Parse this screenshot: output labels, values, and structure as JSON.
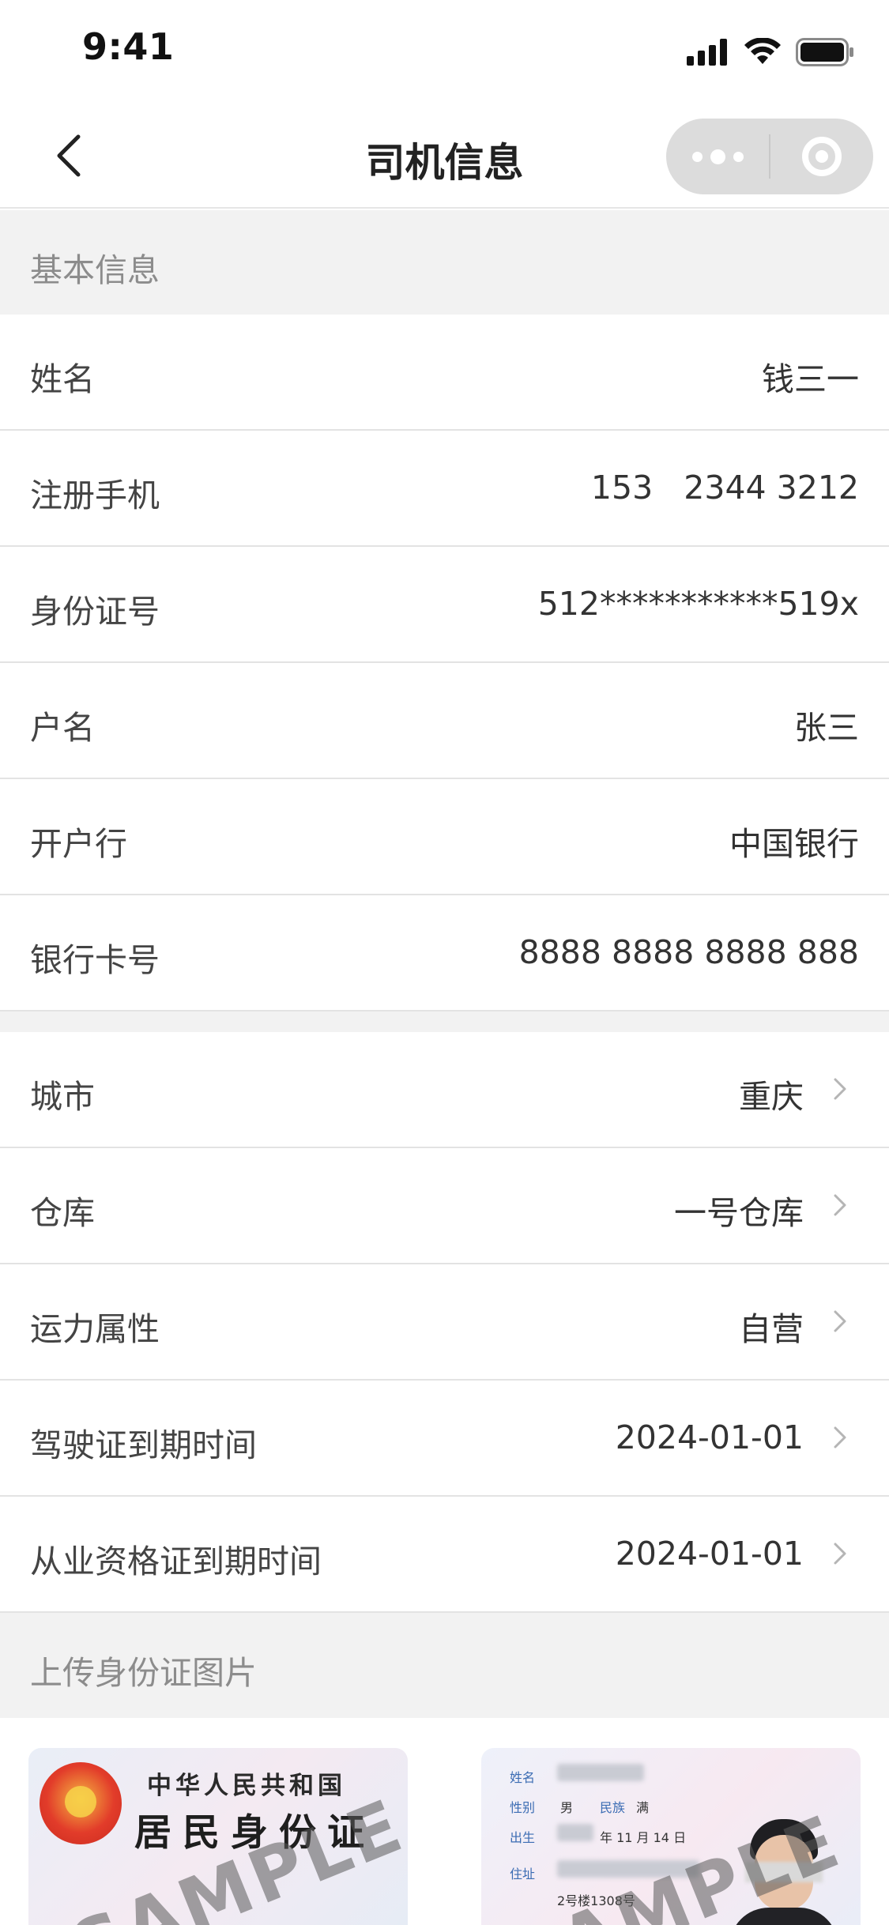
{
  "status_bar": {
    "time": "9:41"
  },
  "nav": {
    "title": "司机信息"
  },
  "basic_section": {
    "header": "基本信息",
    "rows": [
      {
        "label": "姓名",
        "value": "钱三一"
      },
      {
        "label": "注册手机",
        "value": "153   2344 3212"
      },
      {
        "label": "身份证号",
        "value": "512***********519x"
      },
      {
        "label": "户名",
        "value": "张三"
      },
      {
        "label": "开户行",
        "value": "中国银行"
      },
      {
        "label": "银行卡号",
        "value": "8888 8888 8888 888"
      }
    ]
  },
  "select_section": {
    "rows": [
      {
        "label": "城市",
        "value": "重庆"
      },
      {
        "label": "仓库",
        "value": "一号仓库"
      },
      {
        "label": "运力属性",
        "value": "自营"
      },
      {
        "label": "驾驶证到期时间",
        "value": "2024-01-01"
      },
      {
        "label": "从业资格证到期时间",
        "value": "2024-01-01"
      }
    ]
  },
  "upload_section": {
    "header": "上传身份证图片",
    "front_card": {
      "line1": "中华人民共和国",
      "line2": "居民身份证",
      "watermark": "SAMPLE"
    },
    "back_card": {
      "watermark": "SAMPLE",
      "fields": {
        "name": "姓名",
        "gender": "性别",
        "gender_value": "男",
        "ethnicity": "民族",
        "ethnicity_value": "满",
        "birth": "出生",
        "birth_value": "年 11 月 14 日",
        "address": "住址",
        "address_value": "2号楼1308号"
      }
    }
  },
  "colors": {
    "section_bg": "#f2f2f2",
    "divider": "#e3e3e3",
    "label": "#444444",
    "section_title": "#8c8c8c"
  }
}
